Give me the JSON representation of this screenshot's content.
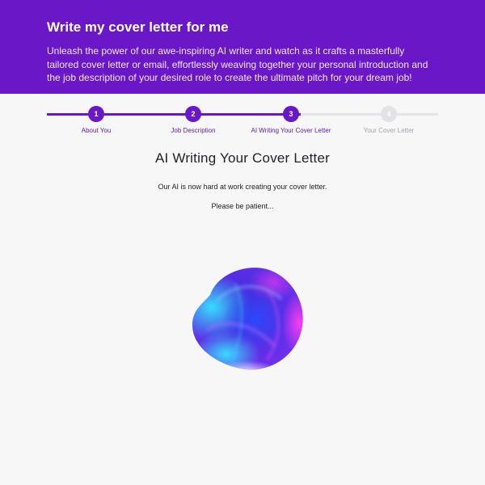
{
  "header": {
    "title": "Write my cover letter for me",
    "description": "Unleash the power of our awe-inspiring AI writer and watch as it crafts a masterfully tailored cover letter or email, effortlessly weaving together your personal introduction and the job description of your desired role to create the ultimate pitch for your dream job!"
  },
  "stepper": {
    "current_step": 3,
    "steps": [
      {
        "number": "1",
        "label": "About You"
      },
      {
        "number": "2",
        "label": "Job Description"
      },
      {
        "number": "3",
        "label": "AI Writing Your Cover Letter"
      },
      {
        "number": "4",
        "label": "Your Cover Letter"
      }
    ]
  },
  "main": {
    "title": "AI Writing Your Cover Letter",
    "status_line": "Our AI is now hard at work creating your cover letter.",
    "patience_line": "Please be patient..."
  },
  "colors": {
    "accent": "#6a17c7",
    "inactive": "#e2e2e7",
    "background": "#f7f7f8"
  }
}
